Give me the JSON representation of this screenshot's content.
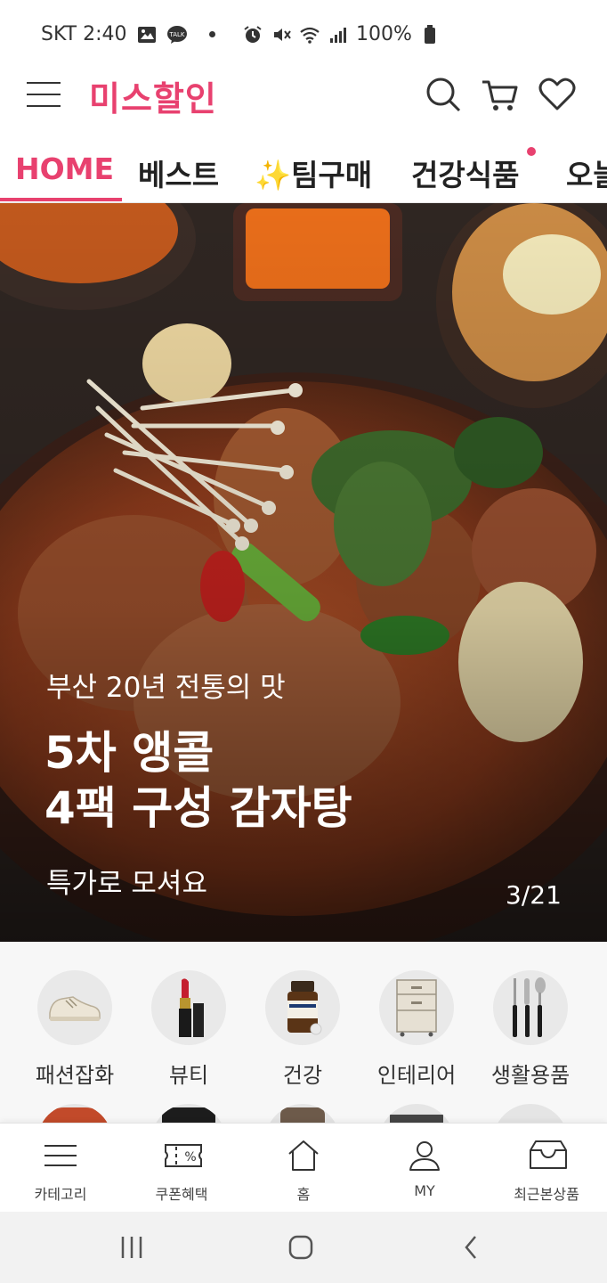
{
  "status_bar": {
    "carrier_time": "SKT 2:40",
    "battery": "100%",
    "icons": [
      "image-icon",
      "talk-icon",
      "alarm-icon",
      "mute-icon",
      "wifi-icon",
      "signal-icon",
      "battery-icon"
    ]
  },
  "header": {
    "logo": "미스할인",
    "icons": [
      "menu-icon",
      "search-icon",
      "cart-icon",
      "heart-icon"
    ]
  },
  "tabs": [
    {
      "label": "HOME",
      "active": true
    },
    {
      "label": "베스트",
      "active": false
    },
    {
      "label": "✨팀구매",
      "active": false
    },
    {
      "label": "건강식품",
      "active": false,
      "badge": true
    },
    {
      "label": "오늘",
      "active": false
    }
  ],
  "hero": {
    "subtitle": "부산 20년 전통의 맛",
    "title_line1": "5차 앵콜",
    "title_line2": "4팩 구성 감자탕",
    "caption": "특가로 모셔요",
    "counter": "3/21"
  },
  "categories": [
    {
      "label": "패션잡화",
      "icon": "sneaker-icon"
    },
    {
      "label": "뷰티",
      "icon": "lipstick-icon"
    },
    {
      "label": "건강",
      "icon": "supplement-bottle-icon"
    },
    {
      "label": "인테리어",
      "icon": "drawer-cabinet-icon"
    },
    {
      "label": "생활용품",
      "icon": "cutlery-icon"
    }
  ],
  "bottom_nav": [
    {
      "label": "카테고리",
      "icon": "menu-icon"
    },
    {
      "label": "쿠폰혜택",
      "icon": "coupon-icon"
    },
    {
      "label": "홈",
      "icon": "home-icon"
    },
    {
      "label": "MY",
      "icon": "person-icon"
    },
    {
      "label": "최근본상품",
      "icon": "inbox-icon"
    }
  ],
  "system_nav": [
    "recents-icon",
    "home-circle-icon",
    "back-icon"
  ],
  "colors": {
    "accent": "#e8416f",
    "text": "#222222",
    "category_bg": "#f7f7f7",
    "system_nav_bg": "#f2f2f2"
  }
}
